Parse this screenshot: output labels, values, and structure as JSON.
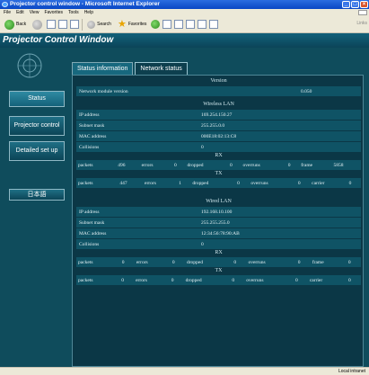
{
  "browser": {
    "title": "Projector control window - Microsoft Internet Explorer",
    "menu": [
      "File",
      "Edit",
      "View",
      "Favorites",
      "Tools",
      "Help"
    ],
    "toolbar": {
      "back": "Back",
      "search": "Search",
      "favorites": "Favorites"
    },
    "links": "Links",
    "status_zone": "Local intranet"
  },
  "page": {
    "title": "Projector Control Window",
    "nav": [
      "Status",
      "Projector control",
      "Detailed set up",
      "日本語"
    ],
    "tabs": [
      "Status information",
      "Network status"
    ],
    "version": {
      "heading": "Version",
      "label": "Network module version",
      "value": "0.050"
    },
    "wireless": {
      "heading": "Wireless LAN",
      "rows": [
        {
          "label": "IP address",
          "value": "169.254.150.27"
        },
        {
          "label": "Subnet mask",
          "value": "255.255.0.0"
        },
        {
          "label": "MAC address",
          "value": "000E18:02:13:C8"
        },
        {
          "label": "Collisions",
          "value": "0"
        }
      ],
      "rx_heading": "RX",
      "rx": [
        "packets",
        "496",
        "errors",
        "0",
        "dropped",
        "0",
        "overruns",
        "0",
        "frame",
        "5858"
      ],
      "tx_heading": "TX",
      "tx": [
        "packets",
        "447",
        "errors",
        "1",
        "dropped",
        "0",
        "overruns",
        "0",
        "carrier",
        "0"
      ]
    },
    "wired": {
      "heading": "Wired LAN",
      "rows": [
        {
          "label": "IP address",
          "value": "192.168.10.100"
        },
        {
          "label": "Subnet mask",
          "value": "255.255.255.0"
        },
        {
          "label": "MAC address",
          "value": "12:34:56:78:90:AB"
        },
        {
          "label": "Collisions",
          "value": "0"
        }
      ],
      "rx_heading": "RX",
      "rx": [
        "packets",
        "0",
        "errors",
        "0",
        "dropped",
        "0",
        "overruns",
        "0",
        "frame",
        "0"
      ],
      "tx_heading": "TX",
      "tx": [
        "packets",
        "0",
        "errors",
        "0",
        "dropped",
        "0",
        "overruns",
        "0",
        "carrier",
        "0"
      ]
    }
  }
}
